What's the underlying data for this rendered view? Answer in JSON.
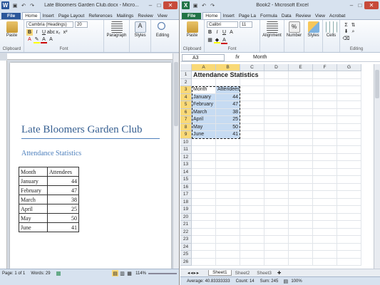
{
  "word": {
    "title": "Late Bloomers Garden Club.docx - Micro...",
    "app_icon": "W",
    "tabs": [
      "File",
      "Home",
      "Insert",
      "Page Layout",
      "References",
      "Mailings",
      "Review",
      "View"
    ],
    "font_name": "Cambria (Headings)",
    "font_size": "20",
    "groups": {
      "clipboard": "Clipboard",
      "font": "Font",
      "paragraph": "Paragraph",
      "styles": "Styles",
      "editing": "Editing",
      "paste": "Paste"
    },
    "document": {
      "heading": "Late Bloomers Garden Club",
      "subheading": "Attendance Statistics",
      "table": {
        "headers": [
          "Month",
          "Attendees"
        ],
        "rows": [
          [
            "January",
            "44"
          ],
          [
            "February",
            "47"
          ],
          [
            "March",
            "38"
          ],
          [
            "April",
            "25"
          ],
          [
            "May",
            "50"
          ],
          [
            "June",
            "41"
          ]
        ]
      }
    },
    "status": {
      "page": "Page: 1 of 1",
      "words": "Words: 29",
      "zoom": "114%"
    }
  },
  "excel": {
    "title": "Book2 - Microsoft Excel",
    "app_icon": "X",
    "tabs": [
      "File",
      "Home",
      "Insert",
      "Page La",
      "Formula",
      "Data",
      "Review",
      "View",
      "Acrobat"
    ],
    "font_name": "Calibri",
    "font_size": "11",
    "groups": {
      "clipboard": "Clipboard",
      "font": "Font",
      "alignment": "Alignment",
      "number": "Number",
      "styles": "Styles",
      "cells": "Cells",
      "editing": "Editing",
      "paste": "Paste"
    },
    "name_box": "A3",
    "fx": "fx",
    "formula": "Month",
    "columns": [
      "A",
      "B",
      "C",
      "D",
      "E",
      "F",
      "G"
    ],
    "rows": [
      "1",
      "2",
      "3",
      "4",
      "5",
      "6",
      "7",
      "8",
      "9",
      "10",
      "11",
      "12",
      "13",
      "14",
      "15",
      "16",
      "17",
      "18",
      "19",
      "20",
      "21",
      "22",
      "23",
      "24",
      "25",
      "26"
    ],
    "cells": {
      "a1": "Attendance Statistics",
      "headers": [
        "Month",
        "Attendees"
      ],
      "data": [
        [
          "January",
          "44"
        ],
        [
          "February",
          "47"
        ],
        [
          "March",
          "38"
        ],
        [
          "April",
          "25"
        ],
        [
          "May",
          "50"
        ],
        [
          "June",
          "41"
        ]
      ]
    },
    "sheets": [
      "Sheet1",
      "Sheet2",
      "Sheet3"
    ],
    "status": {
      "average": "Average: 40.83333333",
      "count": "Count: 14",
      "sum": "Sum: 245",
      "zoom": "100%"
    }
  },
  "colors": {
    "word_accent": "#2b579a",
    "excel_accent": "#217346",
    "heading_blue": "#365f91",
    "selection": "#c6dbf2",
    "selected_header": "#f9d977"
  }
}
